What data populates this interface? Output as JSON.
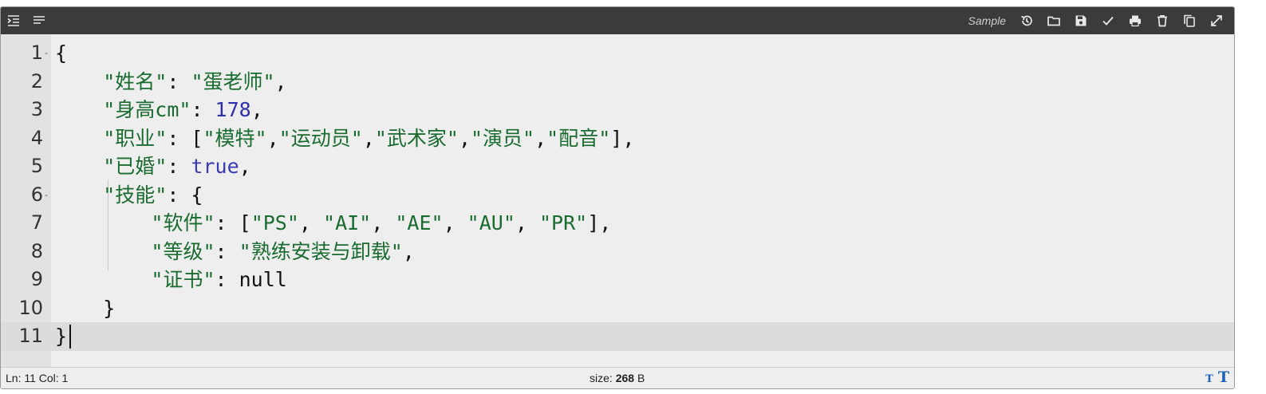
{
  "toolbar": {
    "sample_label": "Sample",
    "left_icons": [
      "indent-icon",
      "menu-icon"
    ],
    "right_icons": [
      "history-icon",
      "folder-icon",
      "save-icon",
      "check-icon",
      "print-icon",
      "trash-icon",
      "copy-icon",
      "expand-icon"
    ]
  },
  "editor": {
    "lines": [
      {
        "num": "1",
        "fold": "-",
        "tokens": [
          [
            "p",
            "{"
          ]
        ]
      },
      {
        "num": "2",
        "fold": "",
        "tokens": [
          [
            "p",
            "    "
          ],
          [
            "s",
            "\"姓名\""
          ],
          [
            "p",
            ": "
          ],
          [
            "s",
            "\"蛋老师\""
          ],
          [
            "p",
            ","
          ]
        ]
      },
      {
        "num": "3",
        "fold": "",
        "tokens": [
          [
            "p",
            "    "
          ],
          [
            "s",
            "\"身高cm\""
          ],
          [
            "p",
            ": "
          ],
          [
            "n",
            "178"
          ],
          [
            "p",
            ","
          ]
        ]
      },
      {
        "num": "4",
        "fold": "",
        "tokens": [
          [
            "p",
            "    "
          ],
          [
            "s",
            "\"职业\""
          ],
          [
            "p",
            ": ["
          ],
          [
            "s",
            "\"模特\""
          ],
          [
            "p",
            ","
          ],
          [
            "s",
            "\"运动员\""
          ],
          [
            "p",
            ","
          ],
          [
            "s",
            "\"武术家\""
          ],
          [
            "p",
            ","
          ],
          [
            "s",
            "\"演员\""
          ],
          [
            "p",
            ","
          ],
          [
            "s",
            "\"配音\""
          ],
          [
            "p",
            "],"
          ]
        ]
      },
      {
        "num": "5",
        "fold": "",
        "tokens": [
          [
            "p",
            "    "
          ],
          [
            "s",
            "\"已婚\""
          ],
          [
            "p",
            ": "
          ],
          [
            "kw",
            "true"
          ],
          [
            "p",
            ","
          ]
        ]
      },
      {
        "num": "6",
        "fold": "-",
        "tokens": [
          [
            "p",
            "    "
          ],
          [
            "s",
            "\"技能\""
          ],
          [
            "p",
            ": {"
          ]
        ]
      },
      {
        "num": "7",
        "fold": "",
        "tokens": [
          [
            "p",
            "        "
          ],
          [
            "s",
            "\"软件\""
          ],
          [
            "p",
            ": ["
          ],
          [
            "s",
            "\"PS\""
          ],
          [
            "p",
            ", "
          ],
          [
            "s",
            "\"AI\""
          ],
          [
            "p",
            ", "
          ],
          [
            "s",
            "\"AE\""
          ],
          [
            "p",
            ", "
          ],
          [
            "s",
            "\"AU\""
          ],
          [
            "p",
            ", "
          ],
          [
            "s",
            "\"PR\""
          ],
          [
            "p",
            "],"
          ]
        ]
      },
      {
        "num": "8",
        "fold": "",
        "tokens": [
          [
            "p",
            "        "
          ],
          [
            "s",
            "\"等级\""
          ],
          [
            "p",
            ": "
          ],
          [
            "s",
            "\"熟练安装与卸载\""
          ],
          [
            "p",
            ","
          ]
        ]
      },
      {
        "num": "9",
        "fold": "",
        "tokens": [
          [
            "p",
            "        "
          ],
          [
            "s",
            "\"证书\""
          ],
          [
            "p",
            ": null"
          ]
        ]
      },
      {
        "num": "10",
        "fold": "",
        "tokens": [
          [
            "p",
            "    }"
          ]
        ]
      },
      {
        "num": "11",
        "fold": "",
        "tokens": [
          [
            "p",
            "}"
          ]
        ]
      }
    ],
    "active_line": 11
  },
  "status": {
    "position": "Ln: 11 Col: 1",
    "size_label": "size:",
    "size_value": "268",
    "size_unit": "B",
    "font_small": "T",
    "font_large": "T"
  },
  "colors": {
    "toolbar_bg": "#3b3b3b",
    "string": "#1a6b2f",
    "number": "#2f2fa8",
    "keyword": "#3a3ab0",
    "font_size_buttons": "#1b63b8"
  }
}
